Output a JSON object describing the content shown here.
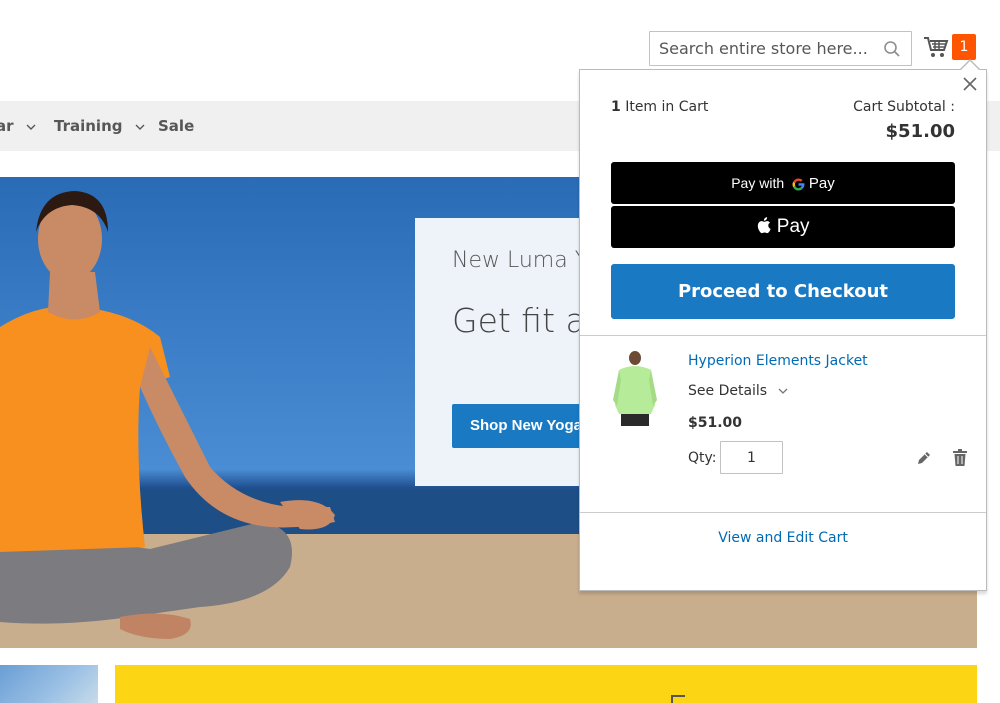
{
  "header": {
    "search": {
      "placeholder": "Search entire store here...",
      "value": ""
    },
    "cart": {
      "count": "1"
    }
  },
  "nav": {
    "items": [
      {
        "label": "ar",
        "has_dropdown": true
      },
      {
        "label": "Training",
        "has_dropdown": true
      },
      {
        "label": "Sale",
        "has_dropdown": false
      }
    ]
  },
  "hero": {
    "eyebrow": "New Luma Y",
    "headline": "Get fit ar seasona",
    "button_label": "Shop New Yoga"
  },
  "minicart": {
    "items_count_number": "1",
    "items_count_label": "Item in Cart",
    "subtotal_label": "Cart Subtotal :",
    "subtotal_value": "$51.00",
    "gpay_label": "Pay with",
    "gpay_brand": "Pay",
    "applepay_label": "Pay",
    "checkout_label": "Proceed to Checkout",
    "product": {
      "name": "Hyperion Elements Jacket",
      "see_details": "See Details",
      "price": "$51.00",
      "qty_label": "Qty:",
      "qty_value": "1"
    },
    "view_cart_label": "View and Edit Cart"
  },
  "colors": {
    "accent": "#1979c3",
    "link": "#006bb4",
    "cart_badge": "#ff5501",
    "promo_yellow": "#fcd515",
    "product_shirt": "#b6eb9a"
  },
  "icons": [
    "search-icon",
    "cart-icon",
    "chevron-down-icon",
    "close-icon",
    "google-g-icon",
    "apple-icon",
    "pencil-icon",
    "trash-icon"
  ]
}
